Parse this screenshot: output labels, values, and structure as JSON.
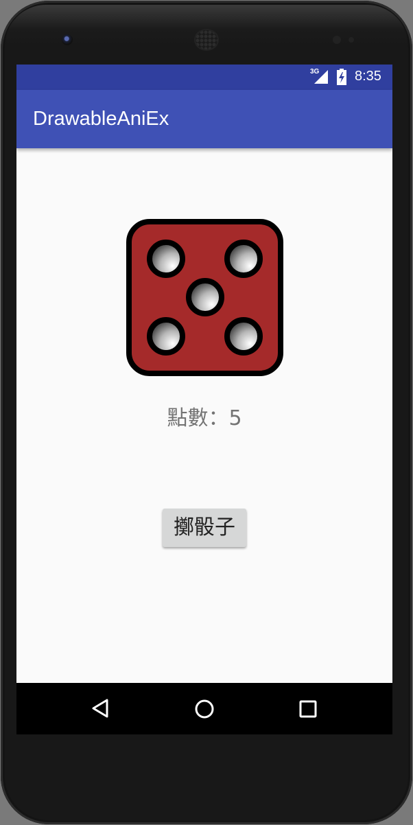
{
  "status_bar": {
    "network": "3G",
    "time": "8:35"
  },
  "app_bar": {
    "title": "DrawableAniEx"
  },
  "dice": {
    "icon": "dice-five-icon",
    "face_value": 5,
    "color": "#a52a2a"
  },
  "result": {
    "text": "點數：5"
  },
  "roll_button": {
    "label": "擲骰子"
  },
  "navigation": {
    "back_icon": "back-icon",
    "home_icon": "home-icon",
    "recents_icon": "recents-icon"
  },
  "colors": {
    "status_bar": "#303f9f",
    "app_bar": "#3f51b5",
    "background": "#fafafa"
  }
}
